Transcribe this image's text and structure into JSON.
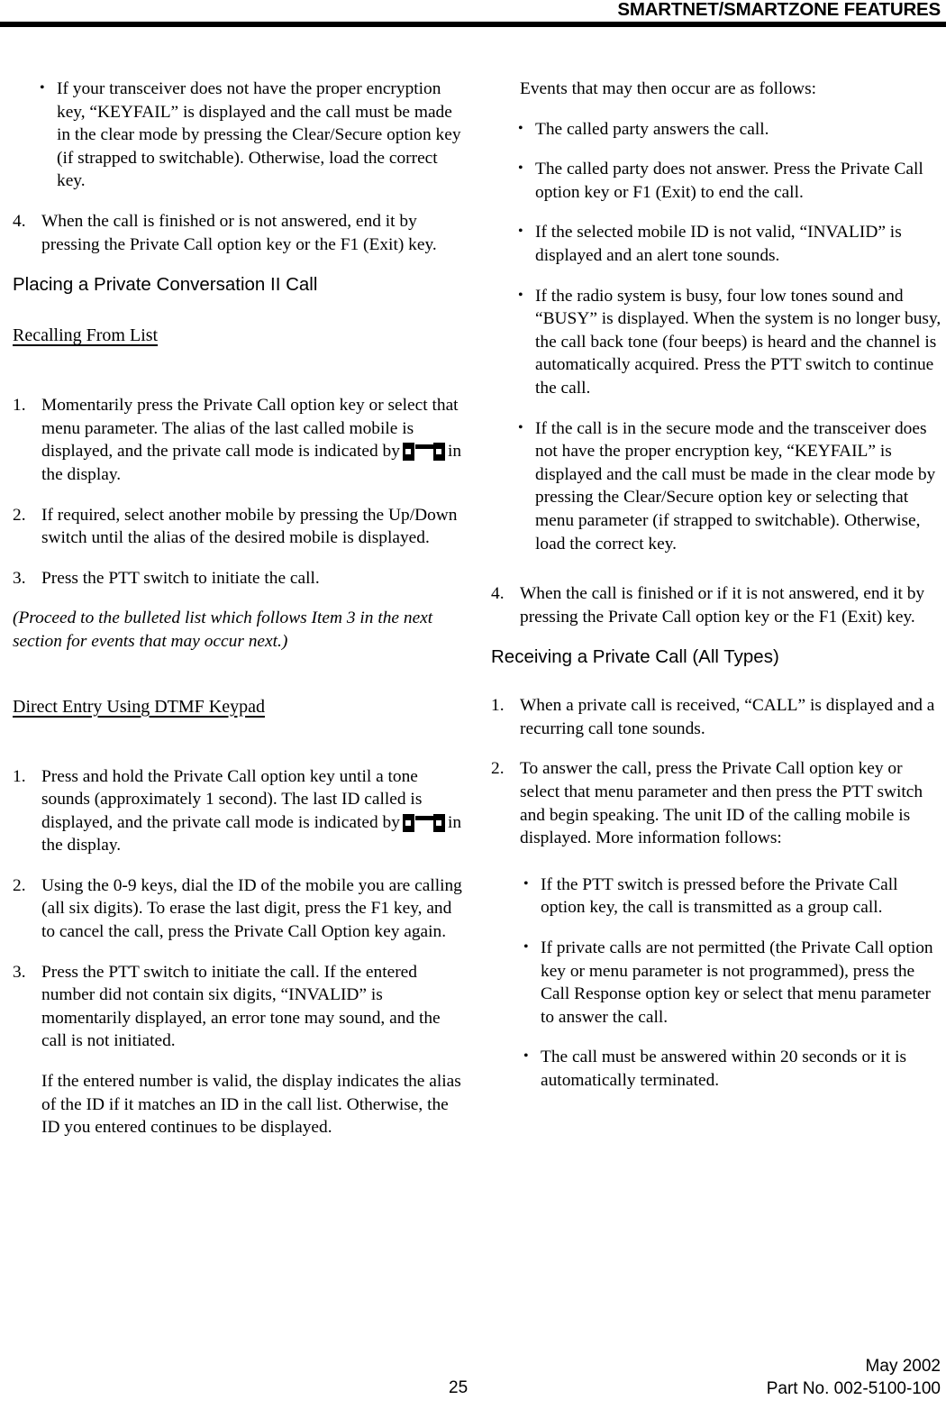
{
  "header": {
    "title": "SMARTNET/SMARTZONE FEATURES"
  },
  "left_column": {
    "bullet_keyfail": "If your transceiver does not have the proper encryption key, “KEYFAIL” is displayed and the call must be made in the clear mode by pressing the Clear/Secure option key (if strapped to switchable). Otherwise, load the correct key.",
    "item4_num": "4.",
    "item4_text": "When the call is finished or is not answered, end it by pressing the Private Call option key or the F1 (Exit) key.",
    "section_heading": "Placing a Private Conversation II Call",
    "subheading_recalling": "Recalling From List",
    "recalling": {
      "item1_num": "1.",
      "item1_text_before_icon": "Momentarily press the Private Call option key or select that menu parameter. The alias of the last called mobile is displayed, and the private call mode is indicated by",
      "item1_text_after_icon": "in the display.",
      "item2_num": "2.",
      "item2_text": "If required, select another mobile by pressing the Up/Down switch until the alias of the desired mobile is displayed.",
      "item3_num": "3.",
      "item3_text": "Press the PTT switch to initiate the call."
    },
    "proceed_note": "(Proceed to the bulleted list which follows Item 3 in the next section for events that may occur next.)",
    "subheading_direct_entry": "Direct Entry Using DTMF Keypad",
    "direct_entry": {
      "item1_num": "1.",
      "item1_text_before_icon": "Press and hold the Private Call option key until a tone sounds (approximately 1 second). The last ID called is displayed, and the private call mode is indicated by",
      "item1_text_after_icon": "in the display.",
      "item2_num": "2.",
      "item2_text": "Using the 0-9 keys, dial the ID of the mobile you are calling (all six digits). To erase the last digit, press the F1 key, and to cancel the call, press the Private Call Option key again.",
      "item3_num": "3.",
      "item3_text": "Press the PTT switch to initiate the call. If the entered number did not contain six digits, “INVALID” is momentarily displayed, an error tone may sound, and the call is not initiated.",
      "item3_para2": "If the entered number is valid, the display indicates the alias of the ID if it matches an ID in the call list. Otherwise, the ID you entered continues to be displayed."
    }
  },
  "right_column": {
    "events_intro": "Events that may then occur are as follows:",
    "events": [
      "The called party answers the call.",
      "The called party does not answer. Press the Private Call option key or F1 (Exit) to end the call.",
      "If the selected mobile ID is not valid, “INVALID” is displayed and an alert tone sounds.",
      "If the radio system is busy, four low tones sound and “BUSY” is displayed. When the system is no longer busy, the call back tone (four beeps) is heard and the channel is automatically acquired. Press the PTT switch to continue the call.",
      "If the call is in the secure mode and the transceiver does not have the proper encryption key, “KEYFAIL” is displayed and the call must be made in the clear mode by pressing the Clear/Secure option key or selecting that menu parameter (if strapped to switchable). Otherwise, load the correct key."
    ],
    "item4_num": "4.",
    "item4_text": "When the call is finished or if it is not answered, end it by pressing the Private Call option key or the F1 (Exit) key.",
    "section_heading": "Receiving a Private Call (All Types)",
    "receiving": {
      "item1_num": "1.",
      "item1_text": "When a private call is received, “CALL” is displayed and a recurring call tone sounds.",
      "item2_num": "2.",
      "item2_text": "To answer the call, press the Private Call option key or select that menu parameter and then press the PTT switch and begin speaking. The unit ID of the calling mobile is displayed. More information follows:",
      "sub_bullets": [
        "If the PTT switch is pressed before the Private Call option key, the call is transmitted as a group call.",
        "If private calls are not permitted (the Private Call option key or menu parameter is not programmed), press the Call Response option key or select that menu parameter to answer the call.",
        "The call must be answered within 20 seconds or it is automatically terminated."
      ]
    }
  },
  "footer": {
    "page_number": "25",
    "date": "May 2002",
    "part_number": "Part No. 002-5100-100"
  },
  "bullet_glyph": "•"
}
